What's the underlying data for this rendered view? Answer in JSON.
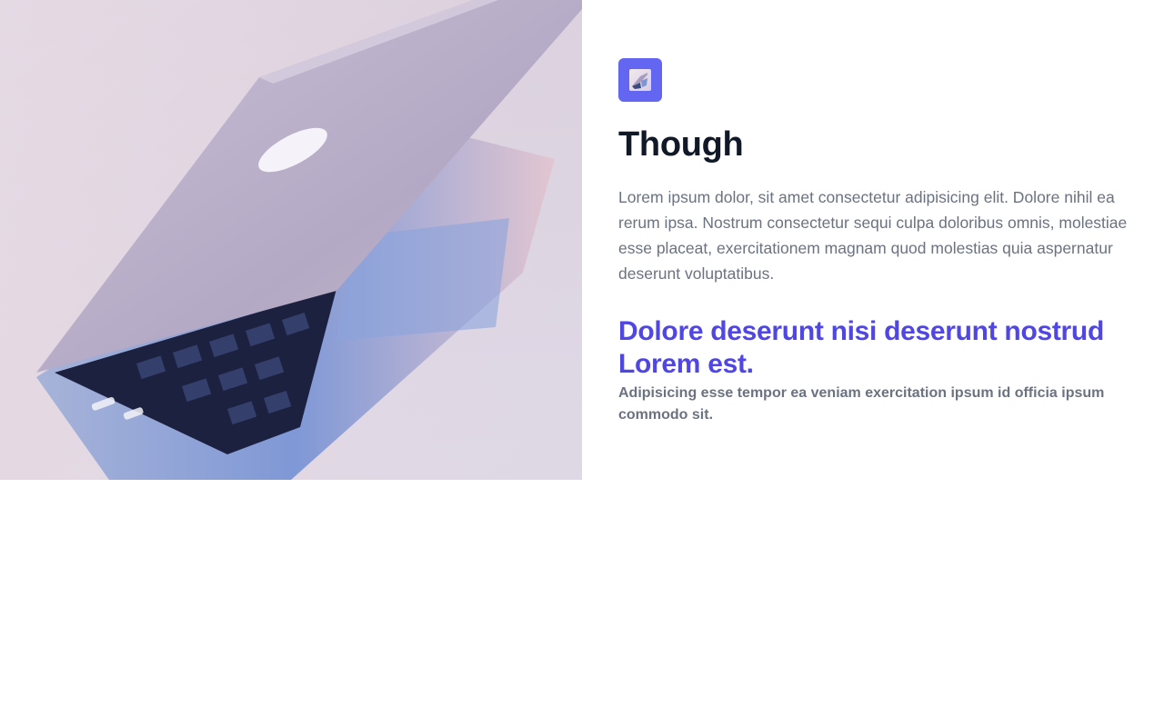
{
  "hero": {
    "image_icon": "laptop-photo",
    "badge_icon": "laptop-thumbnail-icon",
    "accent_color": "#6366f1",
    "title": "Though",
    "body": "Lorem ipsum dolor, sit amet consectetur adipisicing elit. Dolore nihil ea rerum ipsa. Nostrum consectetur sequi culpa doloribus omnis, molestiae esse placeat, exercitationem magnam quod molestias quia aspernatur deserunt voluptatibus.",
    "subheading": "Dolore deserunt nisi deserunt nostrud Lorem est.",
    "subheading_color": "#4f46e5",
    "subtext": "Adipisicing esse tempor ea veniam exercitation ipsum id officia ipsum commodo sit."
  }
}
